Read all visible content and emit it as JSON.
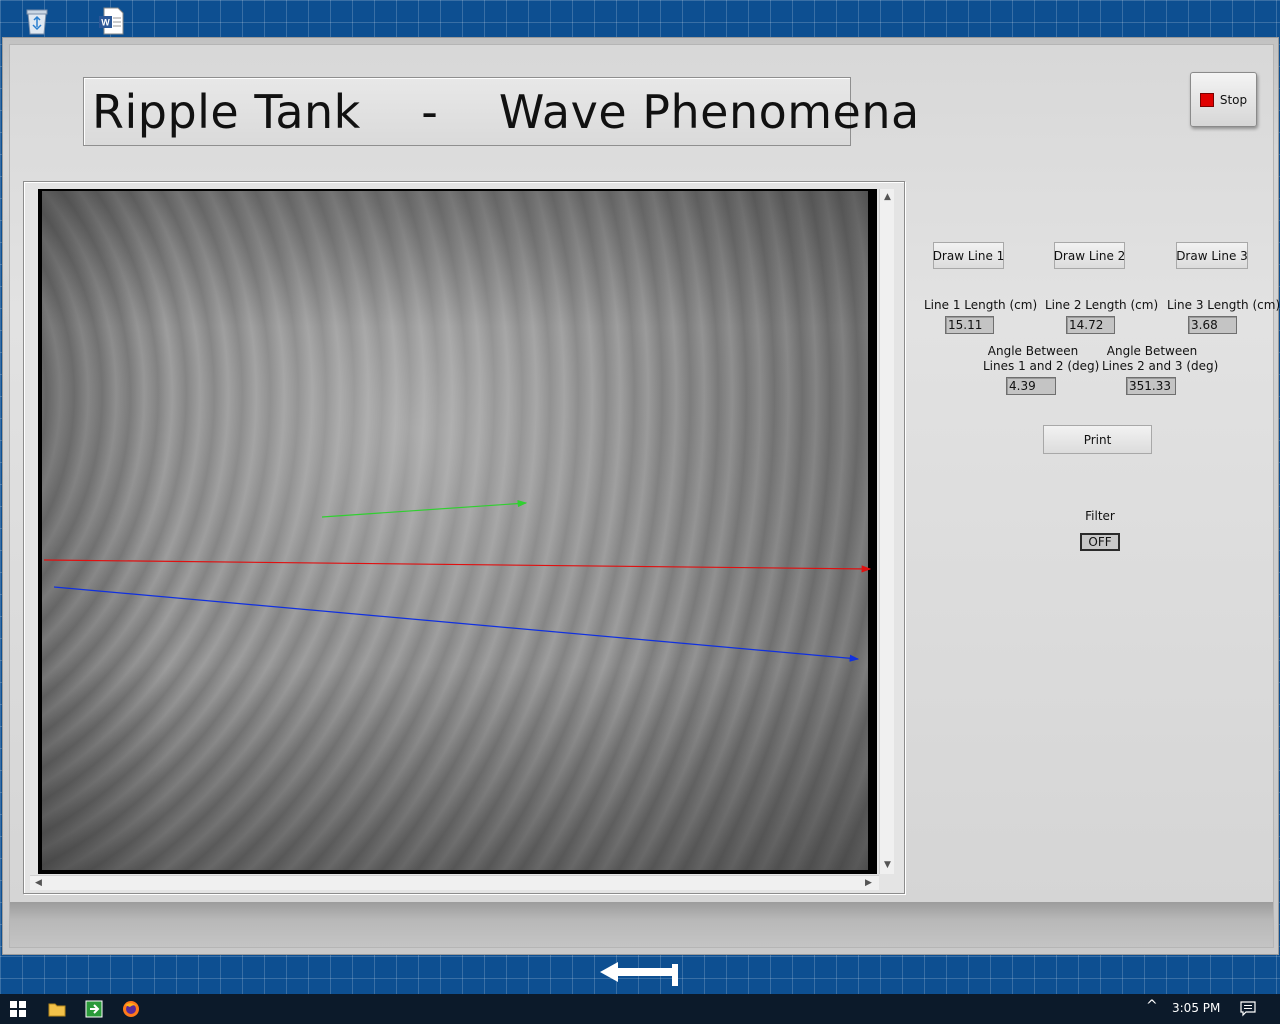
{
  "app": {
    "title": "Ripple Tank    -    Wave Phenomena",
    "stop_label": "Stop"
  },
  "controls": {
    "draw_line_1": "Draw Line 1",
    "draw_line_2": "Draw Line 2",
    "draw_line_3": "Draw Line 3",
    "line1_length_label": "Line 1 Length (cm)",
    "line2_length_label": "Line 2 Length (cm)",
    "line3_length_label": "Line 3 Length (cm)",
    "line1_length": "15.11",
    "line2_length": "14.72",
    "line3_length": "3.68",
    "angle12_label_1": "Angle Between",
    "angle12_label_2": "Lines 1 and 2 (deg)",
    "angle23_label_1": "Angle Between",
    "angle23_label_2": "Lines 2 and 3 (deg)",
    "angle12": "4.39",
    "angle23": "351.33",
    "print_label": "Print",
    "filter_label": "Filter",
    "filter_state": "OFF"
  },
  "overlay_lines": {
    "line1_color": "#e01010",
    "line2_color": "#1030e0",
    "line3_color": "#30d030"
  },
  "taskbar": {
    "time": "3:05 PM",
    "icons": [
      "windows-start-icon",
      "file-explorer-icon",
      "app-icon",
      "firefox-icon"
    ]
  },
  "desktop": {
    "icons": [
      "recycle-bin-icon",
      "word-document-icon"
    ]
  }
}
